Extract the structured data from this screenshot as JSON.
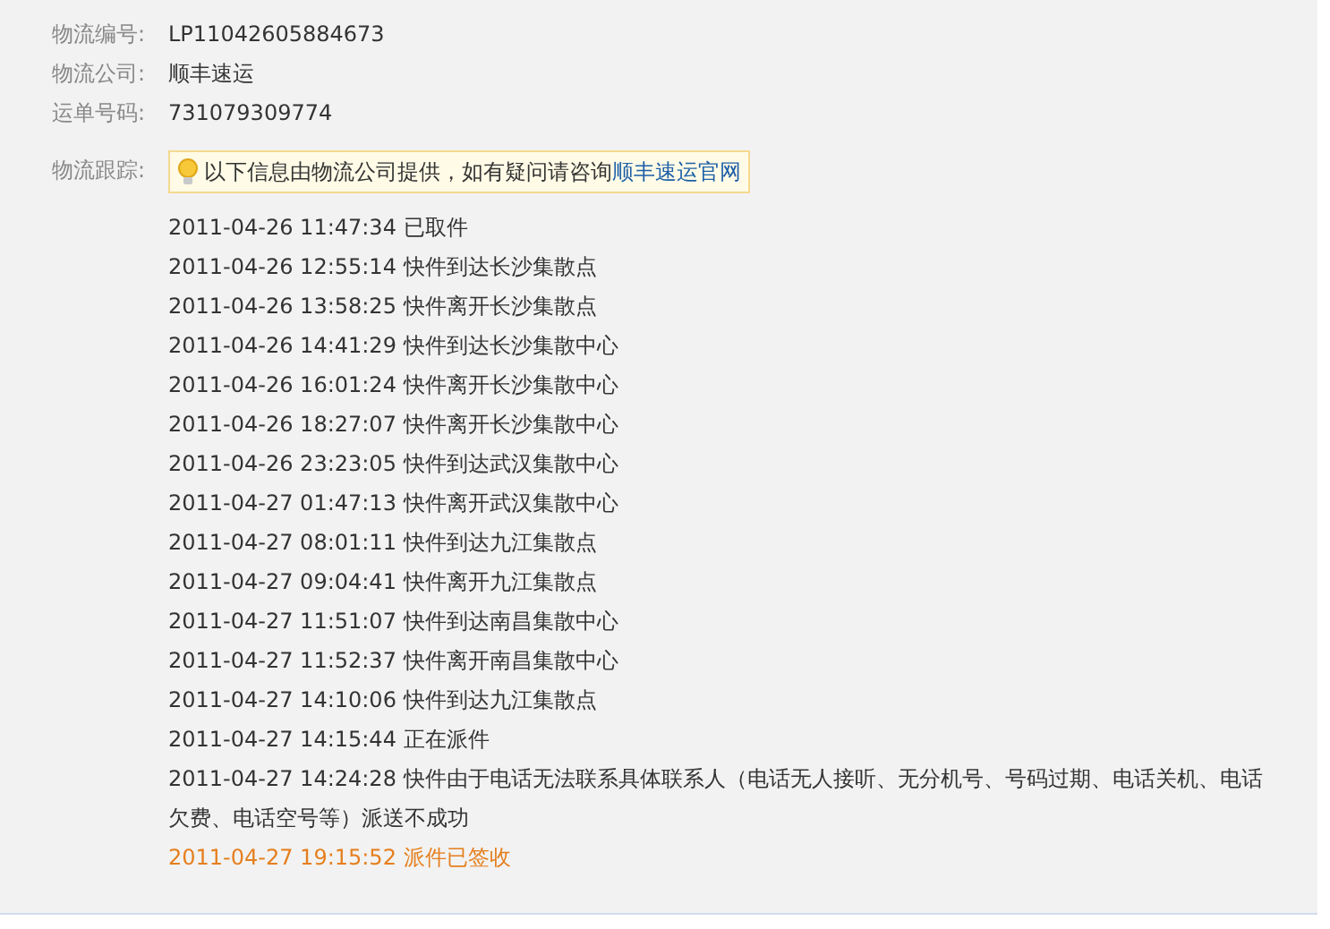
{
  "fields": [
    {
      "label": "物流编号:",
      "value": "LP11042605884673"
    },
    {
      "label": "物流公司:",
      "value": "顺丰速运"
    },
    {
      "label": "运单号码:",
      "value": "731079309774"
    }
  ],
  "tracking": {
    "label": "物流跟踪:",
    "notice": "以下信息由物流公司提供，如有疑问请咨询",
    "link": "顺丰速运官网",
    "events": [
      {
        "time": "2011-04-26 11:47:34",
        "text": "已取件",
        "latest": false
      },
      {
        "time": "2011-04-26 12:55:14",
        "text": "快件到达长沙集散点",
        "latest": false
      },
      {
        "time": "2011-04-26 13:58:25",
        "text": "快件离开长沙集散点",
        "latest": false
      },
      {
        "time": "2011-04-26 14:41:29",
        "text": "快件到达长沙集散中心",
        "latest": false
      },
      {
        "time": "2011-04-26 16:01:24",
        "text": "快件离开长沙集散中心",
        "latest": false
      },
      {
        "time": "2011-04-26 18:27:07",
        "text": "快件离开长沙集散中心",
        "latest": false
      },
      {
        "time": "2011-04-26 23:23:05",
        "text": "快件到达武汉集散中心",
        "latest": false
      },
      {
        "time": "2011-04-27 01:47:13",
        "text": "快件离开武汉集散中心",
        "latest": false
      },
      {
        "time": "2011-04-27 08:01:11",
        "text": "快件到达九江集散点",
        "latest": false
      },
      {
        "time": "2011-04-27 09:04:41",
        "text": "快件离开九江集散点",
        "latest": false
      },
      {
        "time": "2011-04-27 11:51:07",
        "text": "快件到达南昌集散中心",
        "latest": false
      },
      {
        "time": "2011-04-27 11:52:37",
        "text": "快件离开南昌集散中心",
        "latest": false
      },
      {
        "time": "2011-04-27 14:10:06",
        "text": "快件到达九江集散点",
        "latest": false
      },
      {
        "time": "2011-04-27 14:15:44",
        "text": "正在派件",
        "latest": false
      },
      {
        "time": "2011-04-27 14:24:28",
        "text": "快件由于电话无法联系具体联系人（电话无人接听、无分机号、号码过期、电话关机、电话欠费、电话空号等）派送不成功",
        "latest": false
      },
      {
        "time": "2011-04-27 19:15:52",
        "text": "派件已签收",
        "latest": true
      }
    ]
  }
}
